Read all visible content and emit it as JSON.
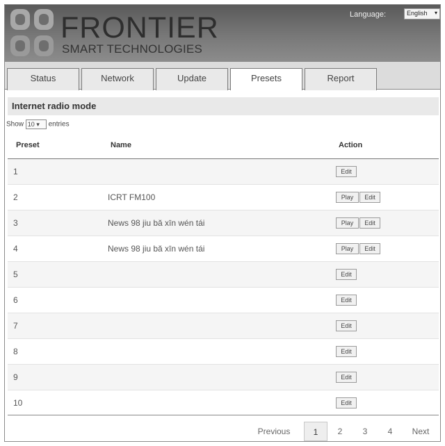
{
  "brand": {
    "name": "FRONTIER",
    "subtitle": "SMART TECHNOLOGIES"
  },
  "language": {
    "label": "Language:",
    "selected": "English",
    "caret": "▾"
  },
  "tabs": [
    {
      "label": "Status",
      "active": false
    },
    {
      "label": "Network",
      "active": false
    },
    {
      "label": "Update",
      "active": false
    },
    {
      "label": "Presets",
      "active": true
    },
    {
      "label": "Report",
      "active": false
    }
  ],
  "section": {
    "title": "Internet radio mode"
  },
  "entries": {
    "prefix": "Show",
    "value": "10",
    "caret": "▾",
    "suffix": "entries"
  },
  "table": {
    "headers": {
      "preset": "Preset",
      "name": "Name",
      "action": "Action"
    },
    "play_label": "Play",
    "edit_label": "Edit",
    "rows": [
      {
        "preset": "1",
        "name": "",
        "actions": [
          "Edit"
        ]
      },
      {
        "preset": "2",
        "name": "ICRT FM100",
        "actions": [
          "Play",
          "Edit"
        ]
      },
      {
        "preset": "3",
        "name": "News 98 jiu bă xīn wén tái",
        "actions": [
          "Play",
          "Edit"
        ]
      },
      {
        "preset": "4",
        "name": "News 98 jiu bă xīn wén tái",
        "actions": [
          "Play",
          "Edit"
        ]
      },
      {
        "preset": "5",
        "name": "",
        "actions": [
          "Edit"
        ]
      },
      {
        "preset": "6",
        "name": "",
        "actions": [
          "Edit"
        ]
      },
      {
        "preset": "7",
        "name": "",
        "actions": [
          "Edit"
        ]
      },
      {
        "preset": "8",
        "name": "",
        "actions": [
          "Edit"
        ]
      },
      {
        "preset": "9",
        "name": "",
        "actions": [
          "Edit"
        ]
      },
      {
        "preset": "10",
        "name": "",
        "actions": [
          "Edit"
        ]
      }
    ]
  },
  "pagination": {
    "previous": "Previous",
    "pages": [
      "1",
      "2",
      "3",
      "4"
    ],
    "current": "1",
    "next": "Next"
  }
}
